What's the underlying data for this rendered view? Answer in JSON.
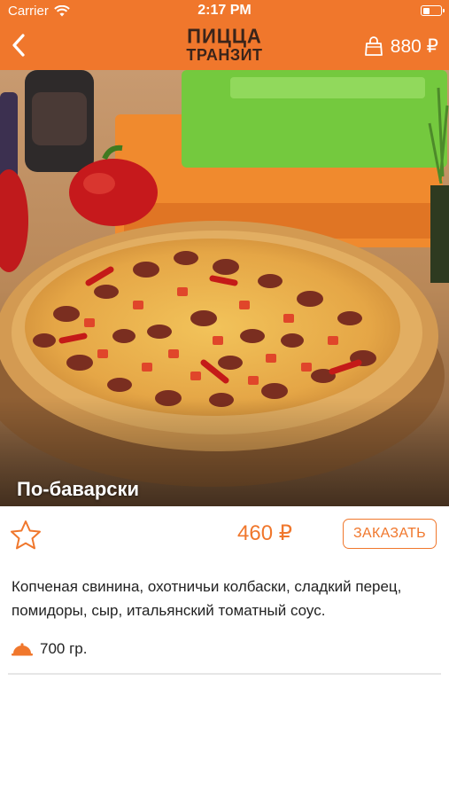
{
  "status_bar": {
    "carrier": "Carrier",
    "time": "2:17 PM"
  },
  "nav": {
    "logo_line1": "ПИЦЦА",
    "logo_line2": "ТРАНЗИТ",
    "cart_total": "880 ₽"
  },
  "product": {
    "title": "По-баварски",
    "price": "460 ₽",
    "order_label": "ЗАКАЗАТЬ",
    "description": "Копченая свинина, охотничьи колбаски, сладкий перец, помидоры, сыр, итальянский томатный соус.",
    "weight": "700 гр."
  },
  "icons": {
    "back": "chevron-left-icon",
    "cart": "shopping-bag-icon",
    "favorite": "star-outline-icon",
    "weight": "dome-icon",
    "wifi": "wifi-icon",
    "battery": "battery-icon"
  },
  "colors": {
    "brand": "#f0772c",
    "logo": "#3a241a",
    "text": "#222222",
    "divider": "#e6e6e6"
  }
}
